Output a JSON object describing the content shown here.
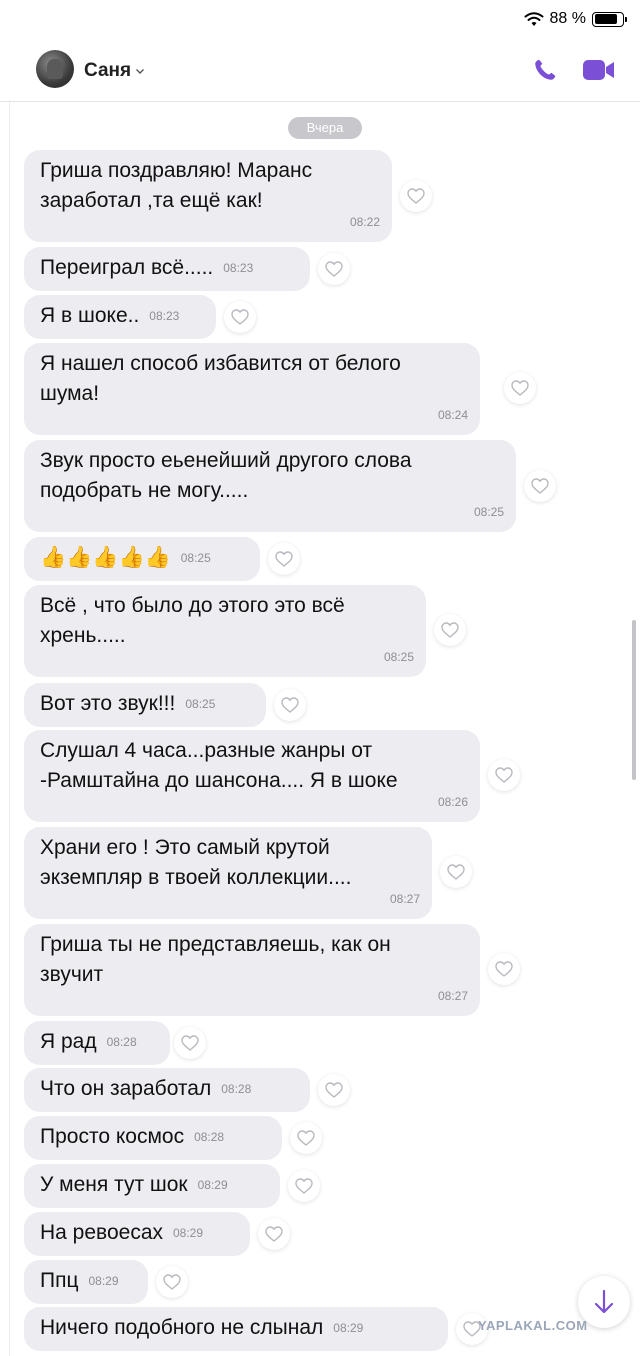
{
  "status_bar": {
    "battery_text": "88 %"
  },
  "header": {
    "contact_name": "Саня"
  },
  "date_separator": "Вчера",
  "messages": [
    {
      "text": "Гриша поздравляю! Маранс\nзаработал ,та ещё как!",
      "time": "08:22"
    },
    {
      "text": "Переиграл всё.....",
      "time": "08:23"
    },
    {
      "text": "Я в шоке..",
      "time": "08:23"
    },
    {
      "text": "Я нашел способ избавится от белого\nшума!",
      "time": "08:24"
    },
    {
      "text": "Звук просто еьенейший другого слова\nподобрать не могу.....",
      "time": "08:25"
    },
    {
      "text": "👍👍👍👍👍",
      "time": "08:25"
    },
    {
      "text": "Всё , что было до этого это всё\nхрень.....",
      "time": "08:25"
    },
    {
      "text": "Вот это звук!!!",
      "time": "08:25"
    },
    {
      "text": "Слушал 4 часа...разные жанры от\n-Рамштайна до шансона.... Я в шоке",
      "time": "08:26"
    },
    {
      "text": "Храни его ! Это самый крутой\nэкземпляр в твоей коллекции....",
      "time": "08:27"
    },
    {
      "text": "Гриша ты не представляешь, как он\nзвучит",
      "time": "08:27"
    },
    {
      "text": "Я рад",
      "time": "08:28"
    },
    {
      "text": "Что он заработал",
      "time": "08:28"
    },
    {
      "text": "Просто космос",
      "time": "08:28"
    },
    {
      "text": "У меня тут шок",
      "time": "08:29"
    },
    {
      "text": "На ревоесах",
      "time": "08:29"
    },
    {
      "text": "Ппц",
      "time": "08:29"
    },
    {
      "text": "Ничего подобного не слынал",
      "time": "08:29"
    }
  ],
  "watermark": "YAPLAKAL.COM",
  "colors": {
    "accent": "#7b4fd6",
    "bubble": "#ececf1"
  },
  "icons": {
    "call": "phone-icon",
    "video": "video-camera-icon",
    "like": "heart-icon",
    "scroll": "arrow-down-icon"
  }
}
